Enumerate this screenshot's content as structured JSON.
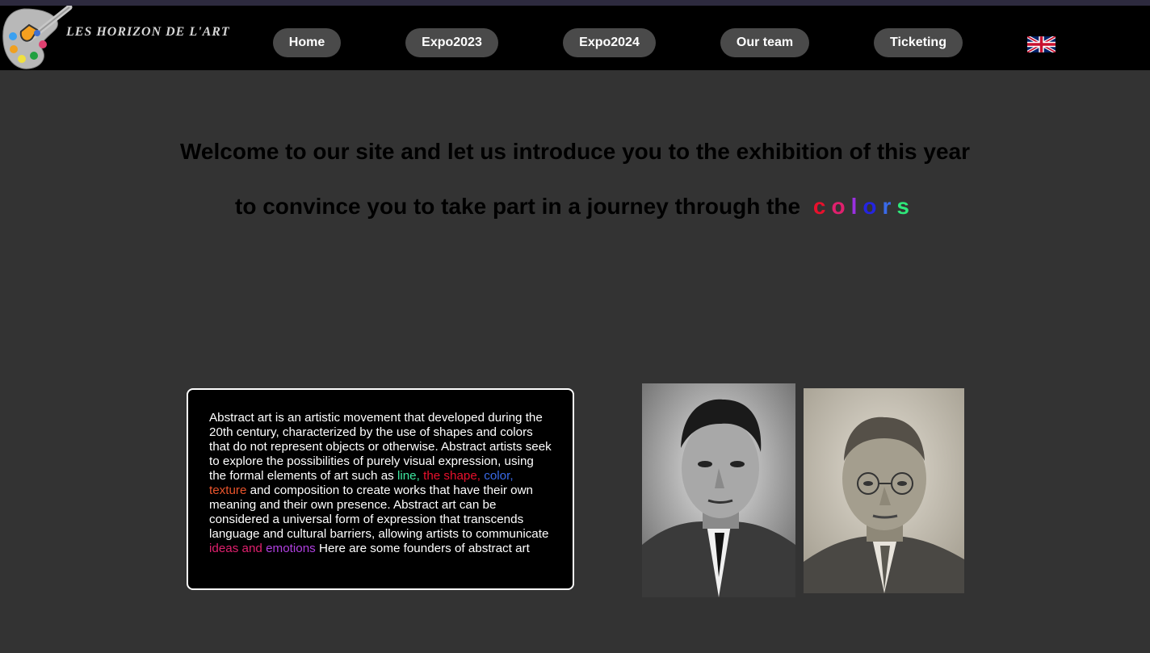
{
  "brand": {
    "name": "LES HORIZON DE L'ART",
    "logo_icon": "palette-icon"
  },
  "nav": {
    "items": [
      {
        "label": "Home"
      },
      {
        "label": "Expo2023"
      },
      {
        "label": "Expo2024"
      },
      {
        "label": "Our team"
      },
      {
        "label": "Ticketing"
      }
    ],
    "language_icon": "uk-flag-icon"
  },
  "hero": {
    "line1": "Welcome to our site and let us introduce you to the exhibition of this year",
    "line2": "to convince you to take part in a journey through the",
    "colors_letters": [
      {
        "char": "c",
        "color": "#e8102c"
      },
      {
        "char": "o",
        "color": "#e0206e"
      },
      {
        "char": "l",
        "color": "#9b30e0"
      },
      {
        "char": "o",
        "color": "#2424e0"
      },
      {
        "char": "r",
        "color": "#3a6ae8"
      },
      {
        "char": "s",
        "color": "#2ee87a"
      }
    ]
  },
  "intro": {
    "part1": "Abstract art is an artistic movement that developed during the 20th century, characterized by the use of shapes and colors that do not represent objects or otherwise. Abstract artists seek to explore the possibilities of purely visual expression, using the formal elements of art such as ",
    "kw_line": "line,",
    "kw_shape": "the shape,",
    "kw_color": "color,",
    "kw_texture": "texture",
    "part2": " and composition to create works that have their own meaning and their own presence. Abstract art can be considered a universal form of expression that transcends language and cultural barriers, allowing artists to communicate ",
    "kw_ideas": "ideas and",
    "kw_emotions": "emotions",
    "part3": " Here are some founders of abstract art",
    "colors": {
      "line": "#3ee8a0",
      "shape": "#e8102c",
      "color": "#3a6ae8",
      "texture": "#e8542c",
      "ideas": "#e0206e",
      "emotions": "#b040e0"
    }
  },
  "portraits": [
    {
      "icon": "portrait-photo-icon"
    },
    {
      "icon": "portrait-photo-icon"
    }
  ]
}
